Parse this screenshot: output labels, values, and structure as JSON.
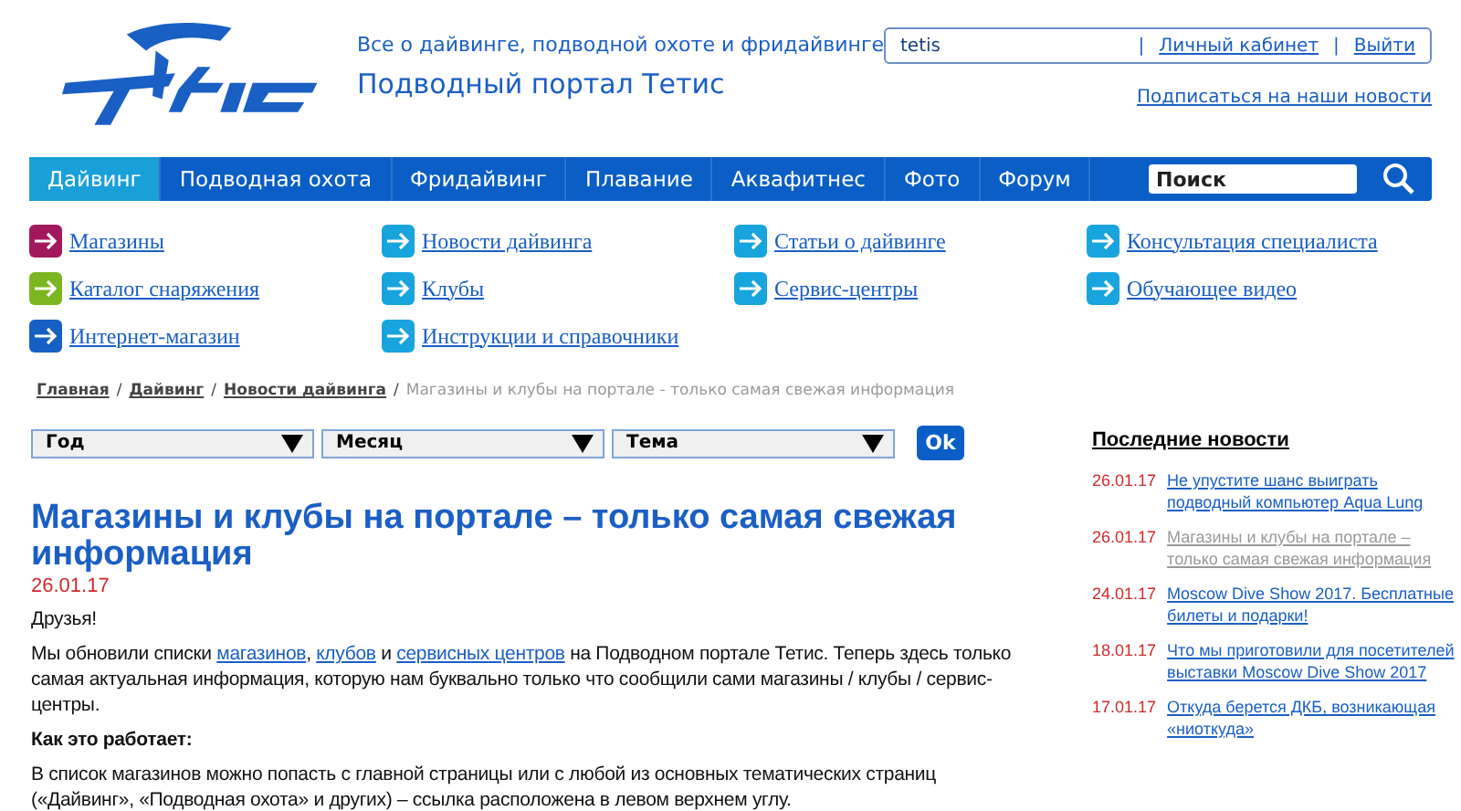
{
  "header": {
    "tagline": "Все о дайвинге, подводной охоте и фридайвинге",
    "site_title": "Подводный портал Тетис",
    "user": {
      "login": "tetis",
      "separator": "|",
      "links": [
        "Личный кабинет",
        "Выйти"
      ]
    },
    "subscribe": "Подписаться на наши новости"
  },
  "nav": {
    "items": [
      {
        "label": "Дайвинг",
        "selected": true
      },
      {
        "label": "Подводная охота",
        "selected": false
      },
      {
        "label": "Фридайвинг",
        "selected": false
      },
      {
        "label": "Плавание",
        "selected": false
      },
      {
        "label": "Аквафитнес",
        "selected": false
      },
      {
        "label": "Фото",
        "selected": false
      },
      {
        "label": "Форум",
        "selected": false
      }
    ],
    "search": {
      "placeholder": "Поиск"
    }
  },
  "quick_links": [
    {
      "label": "Магазины",
      "color": "#a3185c"
    },
    {
      "label": "Новости дайвинга",
      "color": "#18a4dc"
    },
    {
      "label": "Статьи о дайвинге",
      "color": "#18a4dc"
    },
    {
      "label": "Консультация специалиста",
      "color": "#18a4dc"
    },
    {
      "label": "Каталог снаряжения",
      "color": "#7bb51f"
    },
    {
      "label": "Клубы",
      "color": "#18a4dc"
    },
    {
      "label": "Сервис-центры",
      "color": "#18a4dc"
    },
    {
      "label": "Обучающее видео",
      "color": "#18a4dc"
    },
    {
      "label": "Интернет-магазин",
      "color": "#1560c4"
    },
    {
      "label": "Инструкции и справочники",
      "color": "#18a4dc"
    }
  ],
  "breadcrumbs": {
    "separator": "/",
    "links": [
      "Главная",
      "Дайвинг",
      "Новости дайвинга"
    ],
    "current": "Магазины и клубы на портале - только самая свежая информация"
  },
  "filters": {
    "selects": [
      "Год",
      "Месяц",
      "Тема"
    ],
    "button": "Ok"
  },
  "article": {
    "title": "Магазины и клубы на портале – только самая свежая информация",
    "date": "26.01.17",
    "greeting": "Друзья!",
    "paragraph": [
      {
        "text": "Мы обновили списки ",
        "link": false
      },
      {
        "text": "магазинов",
        "link": true
      },
      {
        "text": ", ",
        "link": false
      },
      {
        "text": "клубов",
        "link": true
      },
      {
        "text": " и ",
        "link": false
      },
      {
        "text": "сервисных центров",
        "link": true
      },
      {
        "text": " на Подводном портале Тетис. Теперь здесь только самая актуальная информация, которую нам буквально только что сообщили сами магазины / клубы / сервис-центры.",
        "link": false
      }
    ],
    "subheading": "Как это работает:",
    "body": "В список магазинов можно попасть с главной страницы или с любой из основных тематических страниц («Дайвинг», «Подводная охота» и других) – ссылка расположена в левом верхнем углу."
  },
  "latest_news": {
    "title": "Последние новости",
    "items": [
      {
        "date": "26.01.17",
        "title": "Не упустите шанс выиграть подводный компьютер Aqua Lung",
        "selected": false
      },
      {
        "date": "26.01.17",
        "title": "Магазины и клубы на портале – только самая свежая информация",
        "selected": true
      },
      {
        "date": "24.01.17",
        "title": "Moscow Dive Show 2017. Бесплатные билеты и подарки!",
        "selected": false
      },
      {
        "date": "18.01.17",
        "title": "Что мы приготовили для посетителей выставки Moscow Dive Show 2017",
        "selected": false
      },
      {
        "date": "17.01.17",
        "title": "Откуда берется ДКБ, возникающая «ниоткуда»",
        "selected": false
      }
    ]
  }
}
